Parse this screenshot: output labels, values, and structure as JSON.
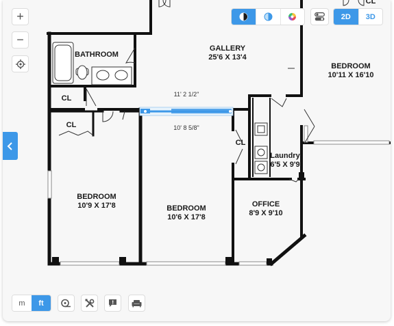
{
  "rooms": {
    "gallery": {
      "name": "GALLERY",
      "dims": "25'6 X 13'4"
    },
    "bathroom": {
      "name": "BATHROOM"
    },
    "bedroom_right": {
      "name": "BEDROOM",
      "dims": "10'11 X 16'10"
    },
    "cl_top": {
      "name": "CL"
    },
    "cl_mid": {
      "name": "CL"
    },
    "cl_right": {
      "name": "CL"
    },
    "laundry": {
      "name": "Laundry",
      "dims": "6'5 X 9'9"
    },
    "bedroom_left": {
      "name": "BEDROOM",
      "dims": "10'9 X 17'8"
    },
    "bedroom_center": {
      "name": "BEDROOM",
      "dims": "10'6 X 17'8"
    },
    "office": {
      "name": "OFFICE",
      "dims": "8'9 X 9'10"
    },
    "top_right_partial": {
      "name": "CL"
    }
  },
  "measurement": {
    "outer": "11' 2 1/2\"",
    "inner": "10' 8 5/8\""
  },
  "view_mode": {
    "options": [
      "2D",
      "3D"
    ],
    "selected": "2D"
  },
  "units": {
    "options": [
      "m",
      "ft"
    ],
    "selected": "ft"
  },
  "zoom": {
    "in_label": "+",
    "out_label": "−"
  },
  "colors": {
    "accent": "#3d98e8",
    "wall": "#111111"
  },
  "icons": {
    "zoom_in": "plus-icon",
    "zoom_out": "minus-icon",
    "locate": "crosshair-icon",
    "contrast": "contrast-icon",
    "half_tone": "half-circle-icon",
    "color_wheel": "color-wheel-icon",
    "layers": "toggle-icon",
    "collapse": "chevron-left-icon",
    "measure": "tape-measure-icon",
    "tools": "tools-icon",
    "feedback": "feedback-icon",
    "furniture": "sofa-icon"
  }
}
